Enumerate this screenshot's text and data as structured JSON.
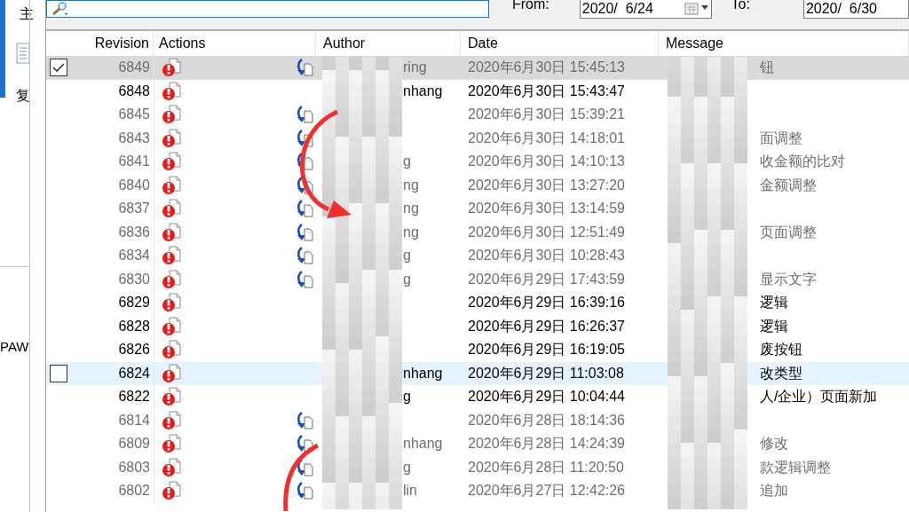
{
  "side_panel": {
    "texts": [
      "主",
      "复",
      "PAW"
    ]
  },
  "filter_bar": {
    "from_label": "From:",
    "from_date": "2020/  6/24",
    "to_label": "To:",
    "to_date": "2020/  6/30"
  },
  "log_table": {
    "columns": [
      "Revision",
      "Actions",
      "Author",
      "Date",
      "Message"
    ],
    "rows": [
      {
        "revision": "6849",
        "merged": true,
        "selected": true,
        "hot": false,
        "checked": true,
        "author": "ring",
        "date": "2020年6月30日 15:45:13",
        "message": "钮"
      },
      {
        "revision": "6848",
        "merged": false,
        "selected": false,
        "hot": false,
        "author": "nhang",
        "date": "2020年6月30日 15:43:47"
      },
      {
        "revision": "6845",
        "merged": true,
        "selected": false,
        "hot": false,
        "date": "2020年6月30日 15:39:21"
      },
      {
        "revision": "6843",
        "merged": true,
        "selected": false,
        "hot": false,
        "date": "2020年6月30日 14:18:01",
        "message": "面调整"
      },
      {
        "revision": "6841",
        "merged": true,
        "selected": false,
        "hot": false,
        "author": "g",
        "date": "2020年6月30日 14:10:13",
        "message": "收金额的比对"
      },
      {
        "revision": "6840",
        "merged": true,
        "selected": false,
        "hot": false,
        "author": "ng",
        "date": "2020年6月30日 13:27:20",
        "message": "金额调整"
      },
      {
        "revision": "6837",
        "merged": true,
        "selected": false,
        "hot": false,
        "author": "ng",
        "date": "2020年6月30日 13:14:59"
      },
      {
        "revision": "6836",
        "merged": true,
        "selected": false,
        "hot": false,
        "author": "ng",
        "date": "2020年6月30日 12:51:49",
        "message": "页面调整"
      },
      {
        "revision": "6834",
        "merged": true,
        "selected": false,
        "hot": false,
        "author": "g",
        "date": "2020年6月30日 10:28:43"
      },
      {
        "revision": "6830",
        "merged": true,
        "selected": false,
        "hot": false,
        "author": "g",
        "date": "2020年6月29日 17:43:59",
        "message": "显示文字"
      },
      {
        "revision": "6829",
        "merged": false,
        "selected": false,
        "hot": false,
        "date": "2020年6月29日 16:39:16",
        "message": "逻辑"
      },
      {
        "revision": "6828",
        "merged": false,
        "selected": false,
        "hot": false,
        "date": "2020年6月29日 16:26:37",
        "message": "逻辑"
      },
      {
        "revision": "6826",
        "merged": false,
        "selected": false,
        "hot": false,
        "date": "2020年6月29日 16:19:05",
        "message": "废按钮"
      },
      {
        "revision": "6824",
        "merged": false,
        "selected": false,
        "hot": true,
        "checked": false,
        "author": "nhang",
        "date": "2020年6月29日 11:03:08",
        "message": "改类型"
      },
      {
        "revision": "6822",
        "merged": false,
        "selected": false,
        "hot": false,
        "author": "g",
        "date": "2020年6月29日 10:04:44",
        "message": "人/企业）页面新加"
      },
      {
        "revision": "6814",
        "merged": true,
        "selected": false,
        "hot": false,
        "date": "2020年6月28日 18:14:36"
      },
      {
        "revision": "6809",
        "merged": true,
        "selected": false,
        "hot": false,
        "author": "nhang",
        "date": "2020年6月28日 14:24:39",
        "message": "修改"
      },
      {
        "revision": "6803",
        "merged": true,
        "selected": false,
        "hot": false,
        "author": "g",
        "date": "2020年6月28日 11:20:50",
        "message": "款逻辑调整"
      },
      {
        "revision": "6802",
        "merged": true,
        "selected": false,
        "hot": false,
        "author": "lin",
        "date": "2020年6月27日 12:42:26",
        "message": "追加"
      }
    ]
  }
}
